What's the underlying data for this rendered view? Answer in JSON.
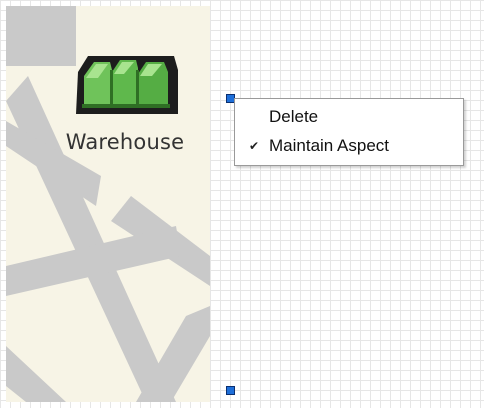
{
  "map": {
    "location_label": "Warehouse",
    "icon": "warehouse-icon"
  },
  "context_menu": {
    "items": [
      {
        "label": "Delete",
        "checked": false
      },
      {
        "label": "Maintain Aspect",
        "checked": true,
        "check_glyph": "✔"
      }
    ]
  },
  "colors": {
    "grid_line": "#e6e6e6",
    "map_background": "#f7f4e6",
    "road": "#c9c9c9",
    "warehouse_green": "#4fae3f",
    "handle": "#1e6fd9"
  }
}
